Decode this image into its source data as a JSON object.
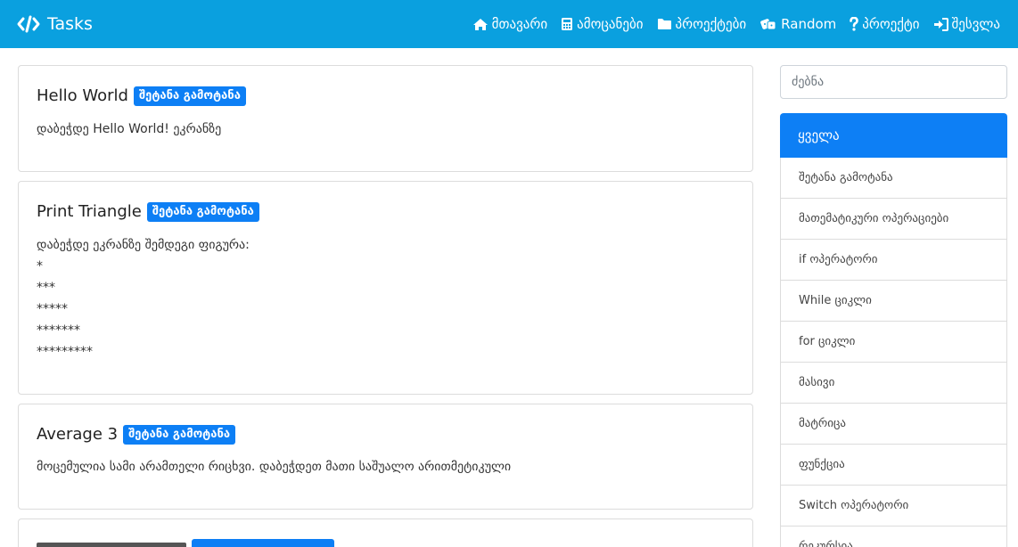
{
  "navbar": {
    "brand": "Tasks",
    "items": [
      "მთავარი",
      "ამოცანები",
      "პროექტები",
      "Random",
      "პროექტი",
      "შესვლა"
    ]
  },
  "tasks": [
    {
      "title": "Hello World",
      "badge": "შეტანა გამოტანა",
      "desc": "დაბეჭდე Hello World! ეკრანზე"
    },
    {
      "title": "Print Triangle",
      "badge": "შეტანა გამოტანა",
      "desc": "დაბეჭდე ეკრანზე შემდეგი ფიგურა:\n*\n***\n*****\n*******\n*********"
    },
    {
      "title": "Average 3",
      "badge": "შეტანა გამოტანა",
      "desc": "მოცემულია სამი არამთელი რიცხვი. დაბეჭდეთ მათი საშუალო არითმეტიკული"
    }
  ],
  "sidebar": {
    "search_placeholder": "ძებნა",
    "active": "ყველა",
    "items": [
      "შეტანა გამოტანა",
      "მათემატიკური ოპერაციები",
      "if ოპერატორი",
      "While ციკლი",
      "for ციკლი",
      "მასივი",
      "მატრიცა",
      "ფუნქცია",
      "Switch ოპერატორი",
      "რეკურსია"
    ]
  }
}
